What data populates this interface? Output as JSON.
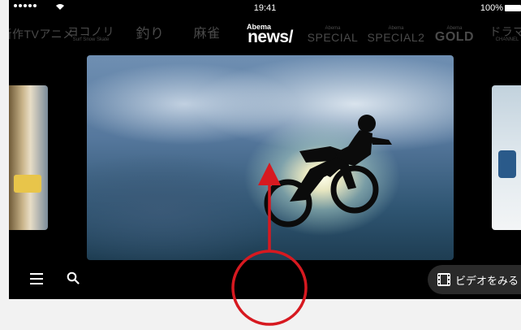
{
  "status_bar": {
    "time": "19:41",
    "battery": "100%"
  },
  "channels": [
    {
      "label": "新作TVアニメ",
      "sub": ""
    },
    {
      "label": "ヨコノリ",
      "sub": "Surf Snow Skate"
    },
    {
      "label": "釣り",
      "sub": ""
    },
    {
      "label": "麻雀",
      "sub": ""
    },
    {
      "label": "news/",
      "sub": "Abema"
    },
    {
      "label": "SPECIAL",
      "sub": "Abema"
    },
    {
      "label": "SPECIAL2",
      "sub": "Abema"
    },
    {
      "label": "GOLD",
      "sub": "Abema"
    },
    {
      "label": "ドラマ",
      "sub": "CHANNEL"
    }
  ],
  "bottom_bar": {
    "watch_video_label": "ビデオをみる"
  },
  "colors": {
    "background": "#000000",
    "inactive_channel": "#4a4a4a",
    "annotation": "#d71920"
  },
  "icons": [
    "menu-icon",
    "search-icon",
    "film-icon",
    "wifi-icon",
    "battery-icon"
  ]
}
